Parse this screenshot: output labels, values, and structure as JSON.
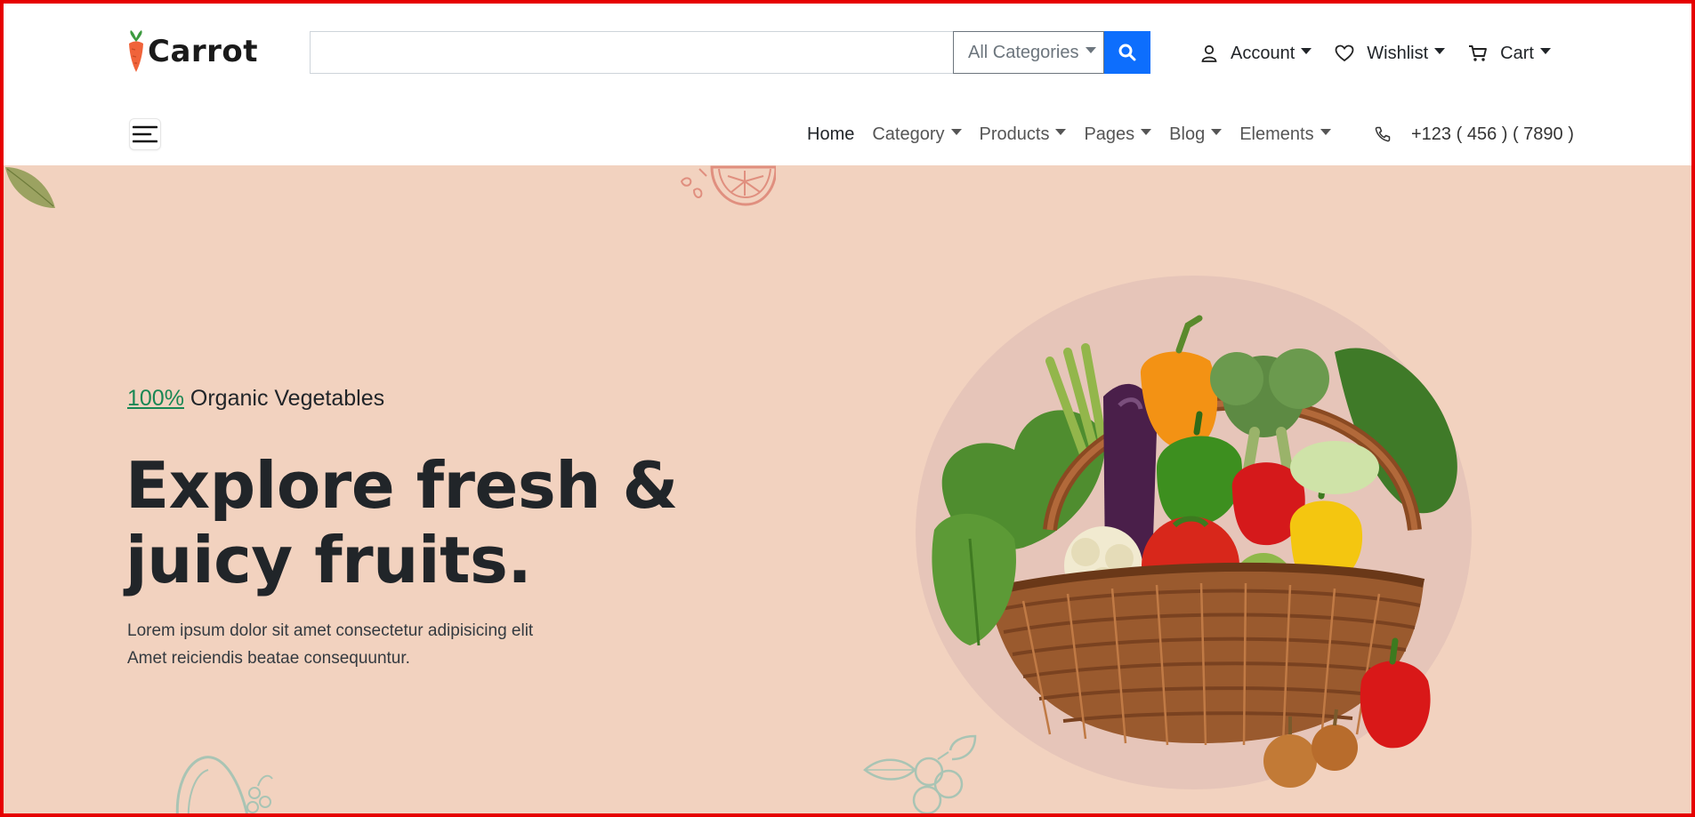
{
  "brand": {
    "name": "Carrot"
  },
  "search": {
    "placeholder": "",
    "category_label": "All Categories",
    "button_icon": "search-icon"
  },
  "header_links": [
    {
      "label": "Account",
      "icon": "user-icon"
    },
    {
      "label": "Wishlist",
      "icon": "heart-icon"
    },
    {
      "label": "Cart",
      "icon": "cart-icon"
    }
  ],
  "nav": {
    "menu_icon": "hamburger-menu-icon",
    "items": [
      "Home",
      "Category",
      "Products",
      "Pages",
      "Blog",
      "Elements"
    ],
    "phone": "+123 ( 456 ) ( 7890 )"
  },
  "hero": {
    "tag_accent": "100%",
    "tag_rest": "Organic Vegetables",
    "headline_line1": "Explore fresh &",
    "headline_line2": "juicy fruits.",
    "desc_line1": "Lorem ipsum dolor sit amet consectetur adipisicing elit",
    "desc_line2": "Amet reiciendis beatae consequuntur."
  },
  "colors": {
    "accent_green": "#198754",
    "search_button": "#0d6efd",
    "hero_bg": "#f2d2bf",
    "frame": "#e60000"
  }
}
